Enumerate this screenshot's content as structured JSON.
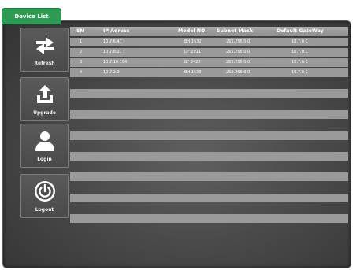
{
  "tab": {
    "label": "Device List"
  },
  "sidebar": {
    "items": [
      {
        "name": "refresh",
        "label": "Refresh",
        "icon": "refresh-icon"
      },
      {
        "name": "upgrade",
        "label": "Upgrade",
        "icon": "upload-icon"
      },
      {
        "name": "login",
        "label": "Login",
        "icon": "user-icon"
      },
      {
        "name": "logout",
        "label": "Logout",
        "icon": "power-icon"
      }
    ]
  },
  "table": {
    "columns": [
      "SN",
      "IP Adress",
      "Model NO.",
      "Subnet Mask",
      "Default GateWay"
    ],
    "rows": [
      [
        "1",
        "10.7.6.47",
        "BH 1532",
        "255.255.0.0",
        "10.7.0.1"
      ],
      [
        "2",
        "10.7.8.21",
        "DF 2911",
        "255.255.0.0",
        "10.7.0.1"
      ],
      [
        "3",
        "10.7.10.104",
        "BF 2422",
        "255.255.0.0",
        "10.7.0.1"
      ],
      [
        "4",
        "10.7.2.2",
        "BH 1530",
        "255.255.0.0",
        "10.7.0.1"
      ]
    ],
    "empty_rows": 10
  },
  "colors": {
    "tab_green": "#2e9b55",
    "row_gray": "#9a9a9a",
    "frame_dark": "#4a4a4a"
  }
}
